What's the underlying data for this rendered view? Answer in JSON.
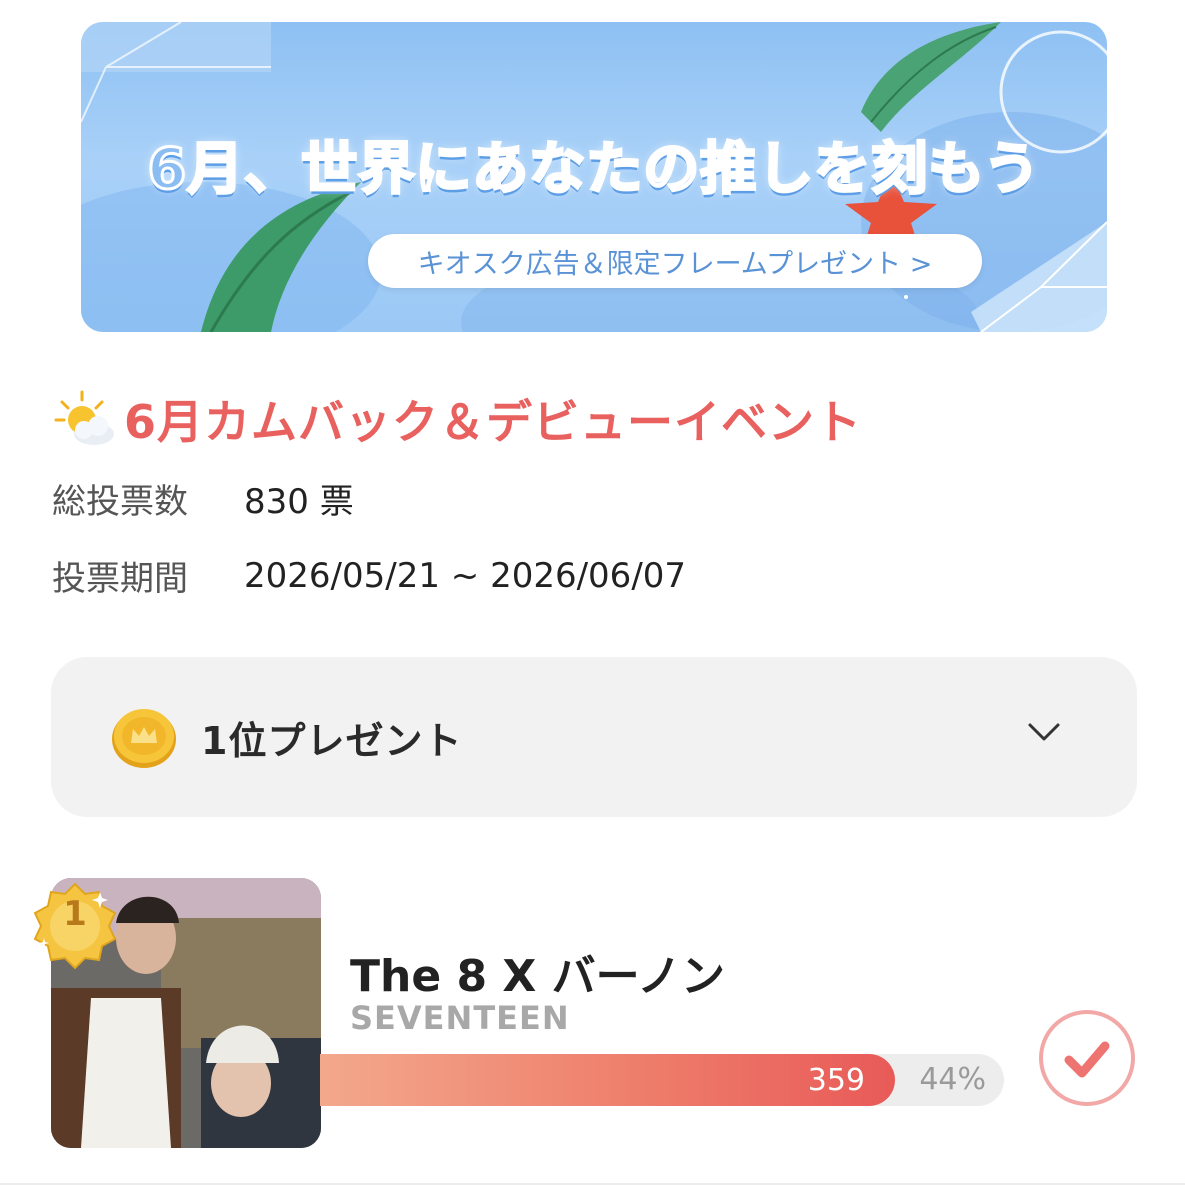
{
  "banner": {
    "title": "6月、世界にあなたの推しを刻もう",
    "pill_label": "キオスク広告＆限定フレームプレゼント >"
  },
  "event": {
    "icon": "sun-behind-cloud-icon",
    "title": "6月カムバック＆デビューイベント",
    "total_votes_label": "総投票数",
    "total_votes_value": "830 票",
    "period_label": "投票期間",
    "period_value": "2026/05/21 ~ 2026/06/07"
  },
  "present": {
    "icon": "crown-coin-icon",
    "label": "1位プレゼント",
    "toggle_icon": "chevron-down-icon"
  },
  "ranking": [
    {
      "rank": "1",
      "name": "The 8 X バーノン",
      "group": "SEVENTEEN",
      "votes": "359",
      "percent": "44%",
      "fill_fraction": 0.84
    }
  ],
  "colors": {
    "accent": "#e8615f",
    "bar_start": "#f3a88c",
    "bar_end": "#e85a58",
    "card_bg": "#f2f2f2"
  }
}
